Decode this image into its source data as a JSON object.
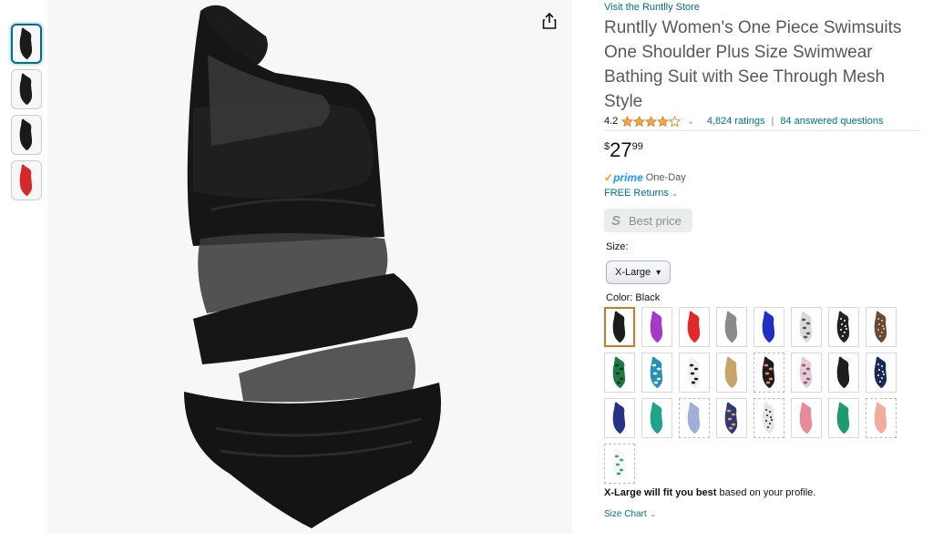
{
  "thumbnails": [
    {
      "name": "thumbnail-1",
      "color": "#1a1a1a",
      "selected": true
    },
    {
      "name": "thumbnail-2",
      "color": "#1a1a1a",
      "selected": false
    },
    {
      "name": "thumbnail-3",
      "color": "#1a1a1a",
      "selected": false
    },
    {
      "name": "thumbnail-4",
      "color": "#d62828",
      "selected": false
    }
  ],
  "product": {
    "store_link": "Visit the Runtlly Store",
    "title": "Runtlly Women's One Piece Swimsuits One Shoulder Plus Size Swimwear Bathing Suit with See Through Mesh Style",
    "rating": "4.2",
    "stars_value": 4.2,
    "ratings_count": "4,824 ratings",
    "answered": "84 answered questions",
    "price_symbol": "$",
    "price_whole": "27",
    "price_fraction": "99",
    "prime_check": "✓",
    "prime_word": "prime",
    "prime_day": "One-Day",
    "returns": "FREE Returns",
    "best_price": "Best price",
    "best_price_icon": "S",
    "size_label": "Size:",
    "size_value": "X-Large",
    "color_label": "Color:",
    "color_value": "Black",
    "fit_bold": "X-Large will fit you best",
    "fit_rest": " based on your profile.",
    "size_chart": "Size Chart"
  },
  "colors": {
    "link": "#007185",
    "star": "#f3a847",
    "selected_swatch_border": "#c77c25"
  },
  "swatches": [
    {
      "name": "swatch-black",
      "fill": "#1c1c1c",
      "pattern": "solid",
      "selected": true
    },
    {
      "name": "swatch-purple",
      "fill": "#a43bc8",
      "pattern": "solid"
    },
    {
      "name": "swatch-red",
      "fill": "#e02828",
      "pattern": "solid"
    },
    {
      "name": "swatch-grey",
      "fill": "#8a8a8a",
      "pattern": "solid"
    },
    {
      "name": "swatch-blue",
      "fill": "#1f2fbf",
      "pattern": "solid"
    },
    {
      "name": "swatch-white-print",
      "fill": "#d9d9d9",
      "pattern": "print",
      "accent": "#555555"
    },
    {
      "name": "swatch-black-dots",
      "fill": "#222222",
      "pattern": "dots",
      "accent": "#ffffff"
    },
    {
      "name": "swatch-leopard",
      "fill": "#6b4a35",
      "pattern": "dots",
      "accent": "#e7c9a4"
    },
    {
      "name": "swatch-green-print",
      "fill": "#1d7a45",
      "pattern": "print",
      "accent": "#0b3b22"
    },
    {
      "name": "swatch-blue-print",
      "fill": "#2a8fb5",
      "pattern": "print",
      "accent": "#e6f5fa"
    },
    {
      "name": "swatch-black-white-print",
      "fill": "#f0f0f0",
      "pattern": "print",
      "accent": "#1a1a1a"
    },
    {
      "name": "swatch-khaki",
      "fill": "#c9a56b",
      "pattern": "solid"
    },
    {
      "name": "swatch-floral-black",
      "fill": "#1c1c1c",
      "pattern": "print",
      "accent": "#f08a6a",
      "dashed": true
    },
    {
      "name": "swatch-pink-print",
      "fill": "#e8c9d6",
      "pattern": "print",
      "accent": "#8a5a70"
    },
    {
      "name": "swatch-black-2",
      "fill": "#1e1e1e",
      "pattern": "solid"
    },
    {
      "name": "swatch-navy-dots",
      "fill": "#1a2a55",
      "pattern": "dots",
      "accent": "#ffffff"
    },
    {
      "name": "swatch-navy",
      "fill": "#283284",
      "pattern": "solid"
    },
    {
      "name": "swatch-teal",
      "fill": "#1fa38c",
      "pattern": "solid"
    },
    {
      "name": "swatch-light-blue",
      "fill": "#9fb0d8",
      "pattern": "solid",
      "dashed": true
    },
    {
      "name": "swatch-navy-orange-print",
      "fill": "#2b3a7a",
      "pattern": "print",
      "accent": "#f39a3a"
    },
    {
      "name": "swatch-black-white-dots",
      "fill": "#e5e5e5",
      "pattern": "dots",
      "accent": "#1a1a1a",
      "dashed": true
    },
    {
      "name": "swatch-pink",
      "fill": "#e88a9a",
      "pattern": "solid"
    },
    {
      "name": "swatch-green",
      "fill": "#1f9a6e",
      "pattern": "solid"
    },
    {
      "name": "swatch-peach",
      "fill": "#f1aba0",
      "pattern": "solid",
      "dashed": true
    },
    {
      "name": "swatch-white-green-print",
      "fill": "#f4f8f6",
      "pattern": "print",
      "accent": "#4c9c8a",
      "dashed": true
    }
  ]
}
